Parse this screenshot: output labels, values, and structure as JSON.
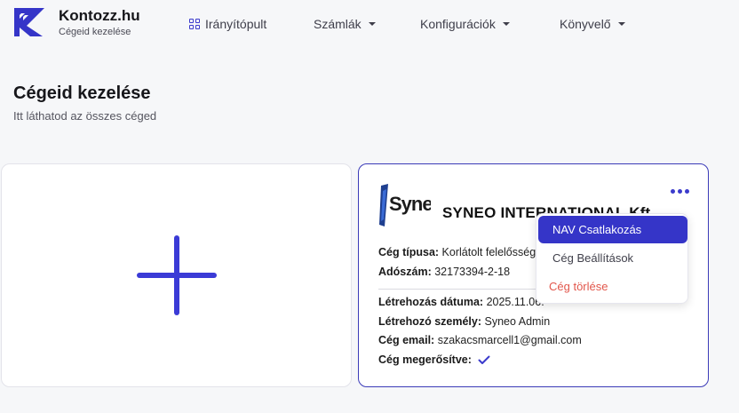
{
  "brand": {
    "name": "Kontozz.hu",
    "subtitle": "Cégeid kezelése",
    "accent_color": "#3b3bd6",
    "logo_icon": "kontozz-logo"
  },
  "nav": {
    "items": [
      {
        "label": "Irányítópult",
        "icon": "grid-icon",
        "has_caret": false
      },
      {
        "label": "Számlák",
        "icon": "",
        "has_caret": true
      },
      {
        "label": "Konfigurációk",
        "icon": "",
        "has_caret": true
      },
      {
        "label": "Könyvelő",
        "icon": "",
        "has_caret": true
      }
    ]
  },
  "page": {
    "title": "Cégeid kezelése",
    "subtitle": "Itt láthatod az összes céged"
  },
  "add_card": {
    "icon": "plus-icon"
  },
  "company": {
    "logo_icon": "syneo-logo",
    "name": "SYNEO INTERNATIONAL Kft.",
    "type_label": "Cég típusa:",
    "type_value": "Korlátolt felelősség",
    "tax_label": "Adószám:",
    "tax_value": "32173394-2-18",
    "created_label": "Létrehozás dátuma:",
    "created_value": "2025.11.06.",
    "creator_label": "Létrehozó személy:",
    "creator_value": "Syneo Admin",
    "email_label": "Cég email:",
    "email_value": "szakacsmarcell1@gmail.com",
    "verified_label": "Cég megerősítve:",
    "verified_icon": "check-icon"
  },
  "menu": {
    "items": [
      {
        "label": "NAV Csatlakozás",
        "state": "active"
      },
      {
        "label": "Cég Beállítások",
        "state": "normal"
      },
      {
        "label": "Cég törlése",
        "state": "danger",
        "color": "#e2574c"
      }
    ]
  }
}
